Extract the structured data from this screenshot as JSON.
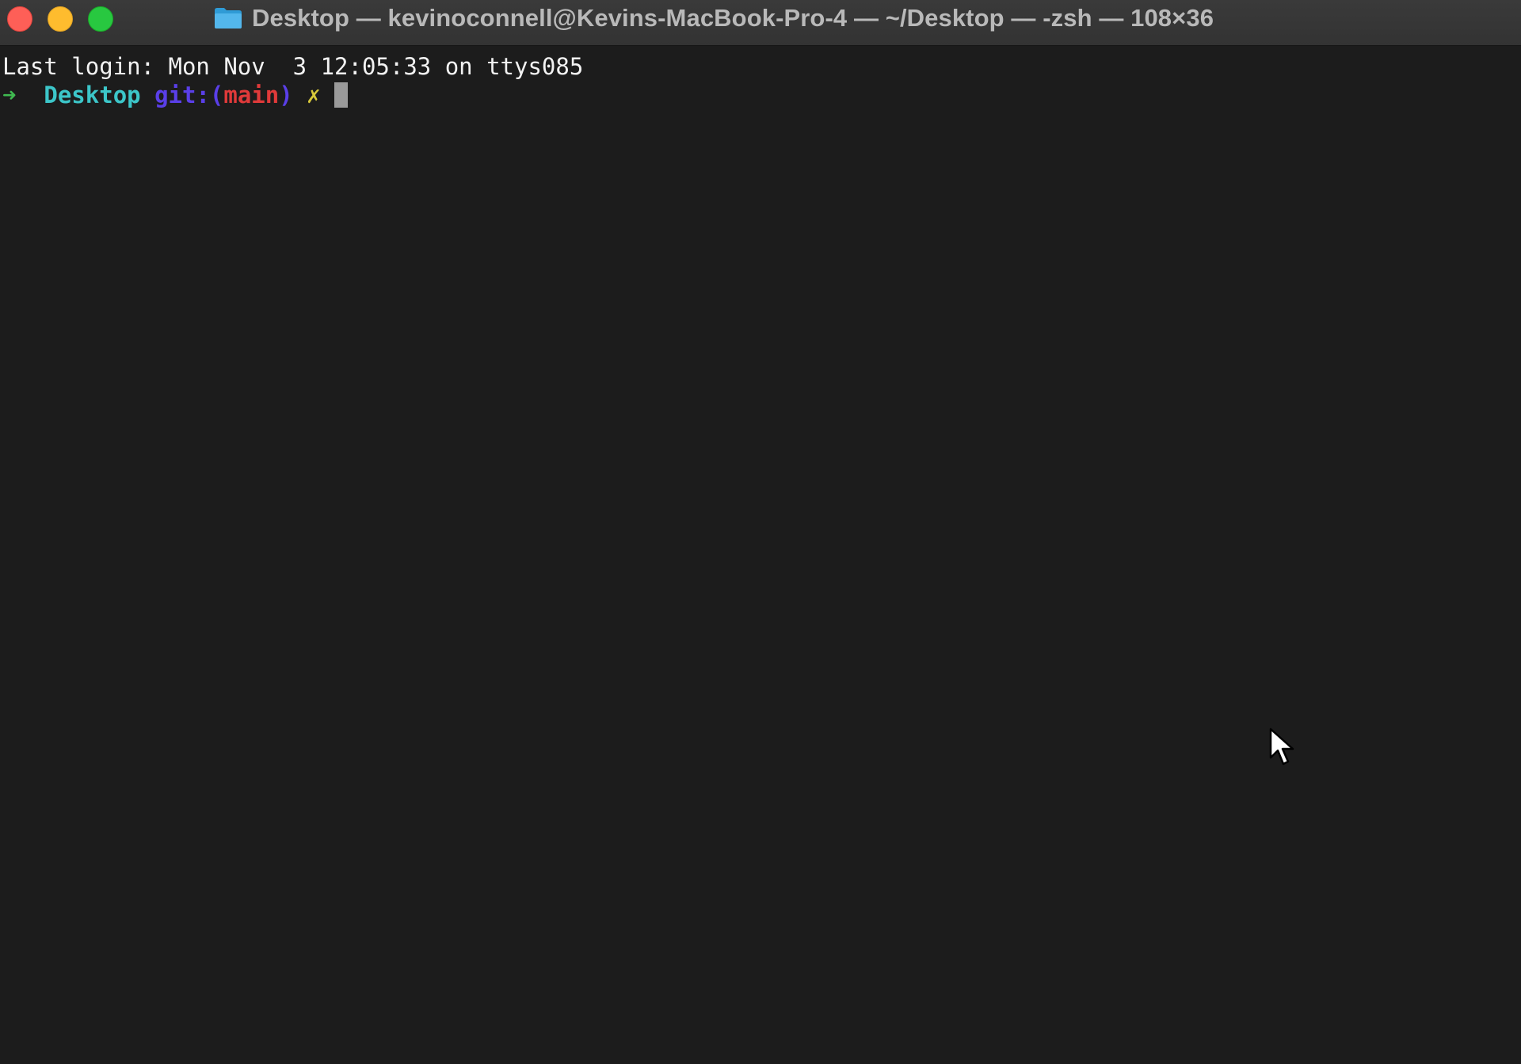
{
  "window": {
    "title": "Desktop — kevinoconnell@Kevins-MacBook-Pro-4 — ~/Desktop — -zsh — 108×36",
    "title_icon": "folder-icon",
    "traffic_lights": {
      "close_color": "#fe5f57",
      "minimize_color": "#febc2e",
      "zoom_color": "#28c840"
    }
  },
  "terminal": {
    "last_login": "Last login: Mon Nov  3 12:05:33 on ttys085",
    "prompt": {
      "arrow": "➜",
      "cwd": "Desktop",
      "git_label": "git:(",
      "git_branch": "main",
      "git_close": ")",
      "dirty_marker": "✗"
    },
    "input": "",
    "colors": {
      "background": "#1c1c1c",
      "arrow": "#3fb950",
      "cwd": "#3cc6c9",
      "git": "#5a3fe8",
      "branch": "#e03a3a",
      "dirty": "#d8c93a"
    }
  }
}
